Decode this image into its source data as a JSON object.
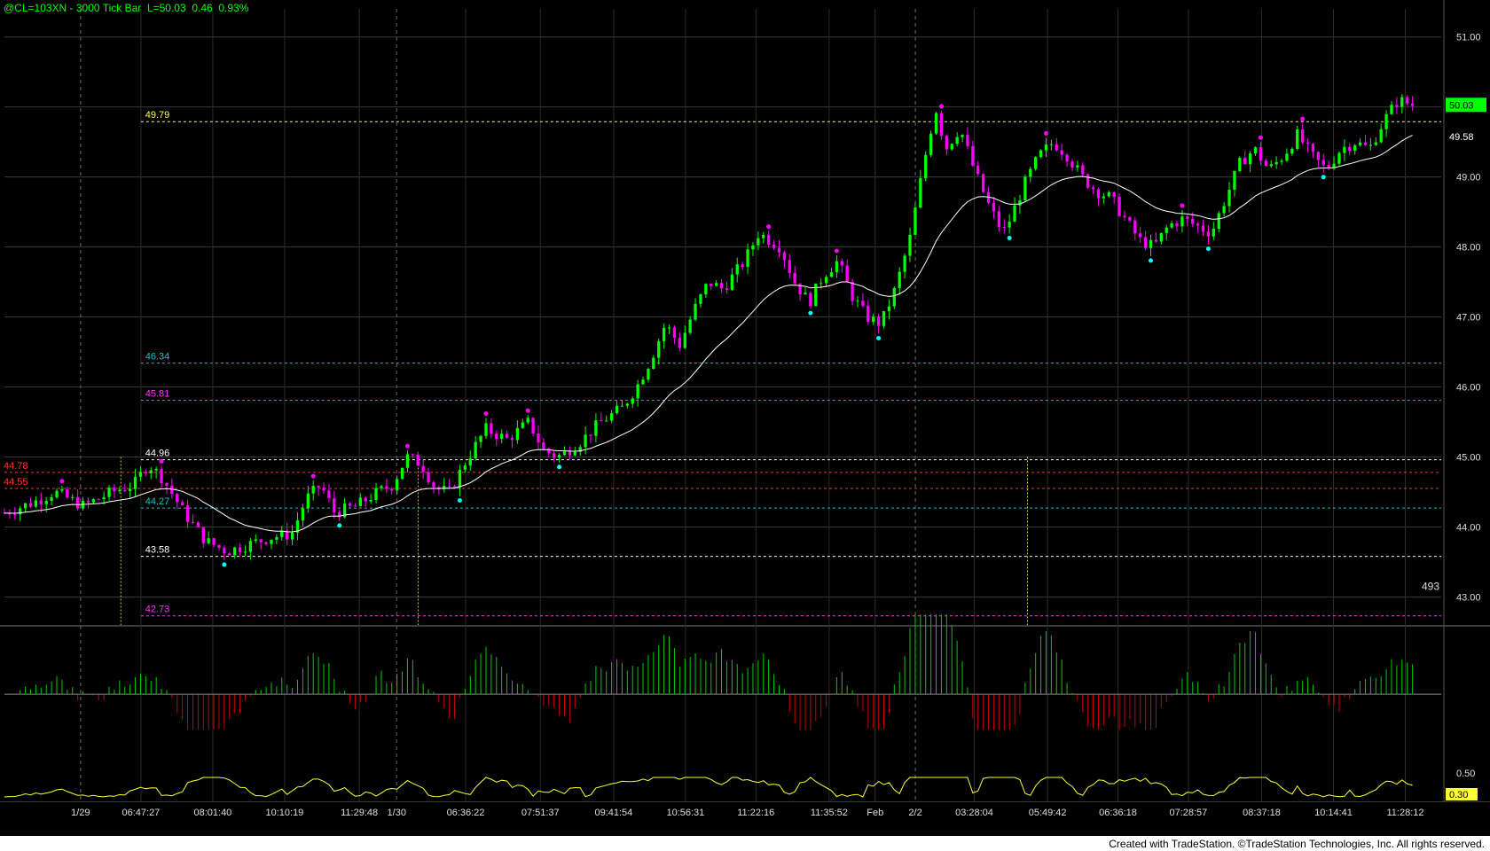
{
  "header": {
    "symbol_text": "@CL=103XN - 3000 Tick Bar",
    "quote_text": "L=50.03  0.46  0.93%"
  },
  "footer": {
    "credit": "Created with TradeStation. ©TradeStation Technologies, Inc. All rights reserved."
  },
  "colors": {
    "background": "#000000",
    "up_bar": "#00ff00",
    "down_bar": "#ff00ff",
    "grid": "#3a3a3a",
    "ma_line": "#ffffff",
    "histogram_pos": "#00cc00",
    "histogram_neg": "#cc0000",
    "osc_line": "#ffff33",
    "high_marker": "#ff00ff",
    "low_marker": "#00ffff"
  },
  "chart_data": {
    "type": "candlestick",
    "title": "@CL=103XN - 3000 Tick Bar",
    "y_axis": {
      "min": 42.6,
      "max": 51.3,
      "ticks": [
        "51.00",
        "50.00",
        "49.00",
        "48.00",
        "47.00",
        "46.00",
        "45.00",
        "44.00",
        "43.00"
      ],
      "tick_values": [
        51,
        50,
        49,
        48,
        47,
        46,
        45,
        44,
        43
      ],
      "last_price_label": "50.03",
      "ma_price_label": "49.58",
      "bar_count_label": "493"
    },
    "x_axis": {
      "ticks": [
        "1/29",
        "06:47:27",
        "08:01:40",
        "10:10:19",
        "11:29:48",
        "1/30",
        "06:36:22",
        "07:51:37",
        "09:41:54",
        "10:56:31",
        "11:22:16",
        "11:35:52",
        "Feb",
        "2/2",
        "03:28:04",
        "05:49:42",
        "06:36:18",
        "07:28:57",
        "08:37:18",
        "10:14:41",
        "11:28:12"
      ],
      "tick_positions": [
        0.053,
        0.095,
        0.145,
        0.195,
        0.247,
        0.273,
        0.321,
        0.373,
        0.424,
        0.474,
        0.523,
        0.574,
        0.606,
        0.634,
        0.675,
        0.726,
        0.775,
        0.824,
        0.875,
        0.925,
        0.975
      ],
      "session_breaks": [
        "1/29",
        "1/30",
        "2/2"
      ]
    },
    "reference_levels": [
      {
        "label": "49.79",
        "value": 49.79,
        "color": "#ffff33"
      },
      {
        "label": "46.34",
        "value": 46.34,
        "color": "#00cccc"
      },
      {
        "label": "45.81",
        "value": 45.81,
        "color": "#ff33ff"
      },
      {
        "label": "44.96",
        "value": 44.96,
        "color": "#ffffff"
      },
      {
        "label": "44.78",
        "value": 44.78,
        "color": "#ff3333"
      },
      {
        "label": "44.55",
        "value": 44.55,
        "color": "#ff3333"
      },
      {
        "label": "44.27",
        "value": 44.27,
        "color": "#00cccc"
      },
      {
        "label": "43.58",
        "value": 43.58,
        "color": "#ffffff"
      },
      {
        "label": "42.73",
        "value": 42.73,
        "color": "#ff33ff"
      }
    ],
    "price_path": [
      [
        0.0,
        44.2
      ],
      [
        0.02,
        44.35
      ],
      [
        0.035,
        44.5
      ],
      [
        0.055,
        44.3
      ],
      [
        0.075,
        44.5
      ],
      [
        0.09,
        44.6
      ],
      [
        0.1,
        44.9
      ],
      [
        0.11,
        44.7
      ],
      [
        0.125,
        44.2
      ],
      [
        0.14,
        43.8
      ],
      [
        0.155,
        43.65
      ],
      [
        0.17,
        43.75
      ],
      [
        0.185,
        43.85
      ],
      [
        0.2,
        43.9
      ],
      [
        0.21,
        44.4
      ],
      [
        0.22,
        44.6
      ],
      [
        0.23,
        44.2
      ],
      [
        0.245,
        44.3
      ],
      [
        0.26,
        44.5
      ],
      [
        0.27,
        44.6
      ],
      [
        0.28,
        45.0
      ],
      [
        0.29,
        44.9
      ],
      [
        0.3,
        44.55
      ],
      [
        0.31,
        44.5
      ],
      [
        0.32,
        44.9
      ],
      [
        0.335,
        45.4
      ],
      [
        0.35,
        45.25
      ],
      [
        0.365,
        45.5
      ],
      [
        0.375,
        45.1
      ],
      [
        0.385,
        45.0
      ],
      [
        0.4,
        45.2
      ],
      [
        0.415,
        45.5
      ],
      [
        0.43,
        45.7
      ],
      [
        0.44,
        46.0
      ],
      [
        0.45,
        46.4
      ],
      [
        0.46,
        46.9
      ],
      [
        0.47,
        46.6
      ],
      [
        0.48,
        47.1
      ],
      [
        0.49,
        47.5
      ],
      [
        0.5,
        47.4
      ],
      [
        0.515,
        47.8
      ],
      [
        0.525,
        48.2
      ],
      [
        0.54,
        48.0
      ],
      [
        0.55,
        47.5
      ],
      [
        0.56,
        47.2
      ],
      [
        0.57,
        47.6
      ],
      [
        0.58,
        47.8
      ],
      [
        0.59,
        47.3
      ],
      [
        0.6,
        47.0
      ],
      [
        0.61,
        46.9
      ],
      [
        0.62,
        47.4
      ],
      [
        0.63,
        48.1
      ],
      [
        0.64,
        49.2
      ],
      [
        0.648,
        50.0
      ],
      [
        0.655,
        49.4
      ],
      [
        0.665,
        49.7
      ],
      [
        0.675,
        49.1
      ],
      [
        0.685,
        48.6
      ],
      [
        0.695,
        48.2
      ],
      [
        0.7,
        48.4
      ],
      [
        0.71,
        48.9
      ],
      [
        0.72,
        49.3
      ],
      [
        0.73,
        49.5
      ],
      [
        0.74,
        49.3
      ],
      [
        0.75,
        49.0
      ],
      [
        0.76,
        48.8
      ],
      [
        0.77,
        48.7
      ],
      [
        0.78,
        48.4
      ],
      [
        0.79,
        48.1
      ],
      [
        0.8,
        48.0
      ],
      [
        0.81,
        48.3
      ],
      [
        0.82,
        48.4
      ],
      [
        0.83,
        48.3
      ],
      [
        0.84,
        48.2
      ],
      [
        0.85,
        48.7
      ],
      [
        0.86,
        49.2
      ],
      [
        0.87,
        49.4
      ],
      [
        0.88,
        49.1
      ],
      [
        0.89,
        49.3
      ],
      [
        0.9,
        49.6
      ],
      [
        0.91,
        49.3
      ],
      [
        0.92,
        49.1
      ],
      [
        0.93,
        49.4
      ],
      [
        0.94,
        49.5
      ],
      [
        0.95,
        49.4
      ],
      [
        0.96,
        49.8
      ],
      [
        0.97,
        50.1
      ],
      [
        0.98,
        50.03
      ]
    ],
    "series": [
      {
        "name": "Price",
        "type": "candlestick"
      },
      {
        "name": "Moving Average",
        "type": "line"
      },
      {
        "name": "Histogram",
        "type": "histogram"
      },
      {
        "name": "Oscillator",
        "type": "line",
        "labels": [
          "0.50",
          "0.30"
        ]
      }
    ],
    "lower_panel": {
      "osc_tick_label": "0.50",
      "osc_last_label": "0.30"
    },
    "grid": true,
    "legend": "none"
  }
}
